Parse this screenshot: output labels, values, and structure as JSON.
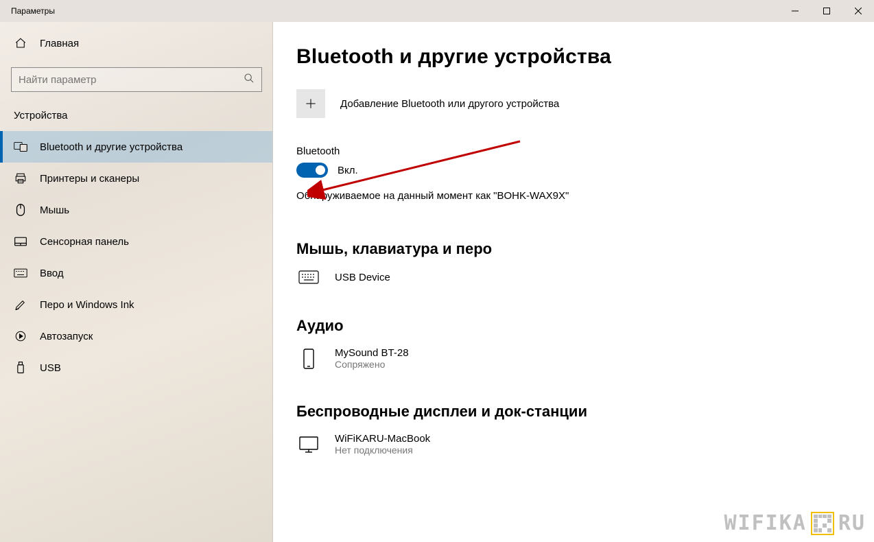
{
  "window": {
    "title": "Параметры"
  },
  "sidebar": {
    "home": "Главная",
    "search_placeholder": "Найти параметр",
    "section": "Устройства",
    "items": [
      {
        "label": "Bluetooth и другие устройства",
        "active": true
      },
      {
        "label": "Принтеры и сканеры",
        "active": false
      },
      {
        "label": "Мышь",
        "active": false
      },
      {
        "label": "Сенсорная панель",
        "active": false
      },
      {
        "label": "Ввод",
        "active": false
      },
      {
        "label": "Перо и Windows Ink",
        "active": false
      },
      {
        "label": "Автозапуск",
        "active": false
      },
      {
        "label": "USB",
        "active": false
      }
    ]
  },
  "main": {
    "title": "Bluetooth и другие устройства",
    "add_device": "Добавление Bluetooth или другого устройства",
    "bt_label": "Bluetooth",
    "toggle_state": "Вкл.",
    "toggle_on": true,
    "discoverable": "Обнаруживаемое на данный момент как \"BOHK-WAX9X\"",
    "sections": {
      "mouse": {
        "title": "Мышь, клавиатура и перо",
        "device_name": "USB Device"
      },
      "audio": {
        "title": "Аудио",
        "device_name": "MySound BT-28",
        "device_status": "Сопряжено"
      },
      "wireless": {
        "title": "Беспроводные дисплеи и док-станции",
        "device_name": "WiFiKARU-MacBook",
        "device_status": "Нет подключения"
      }
    }
  },
  "watermark": {
    "left": "WIFIKA",
    "right": "RU"
  }
}
